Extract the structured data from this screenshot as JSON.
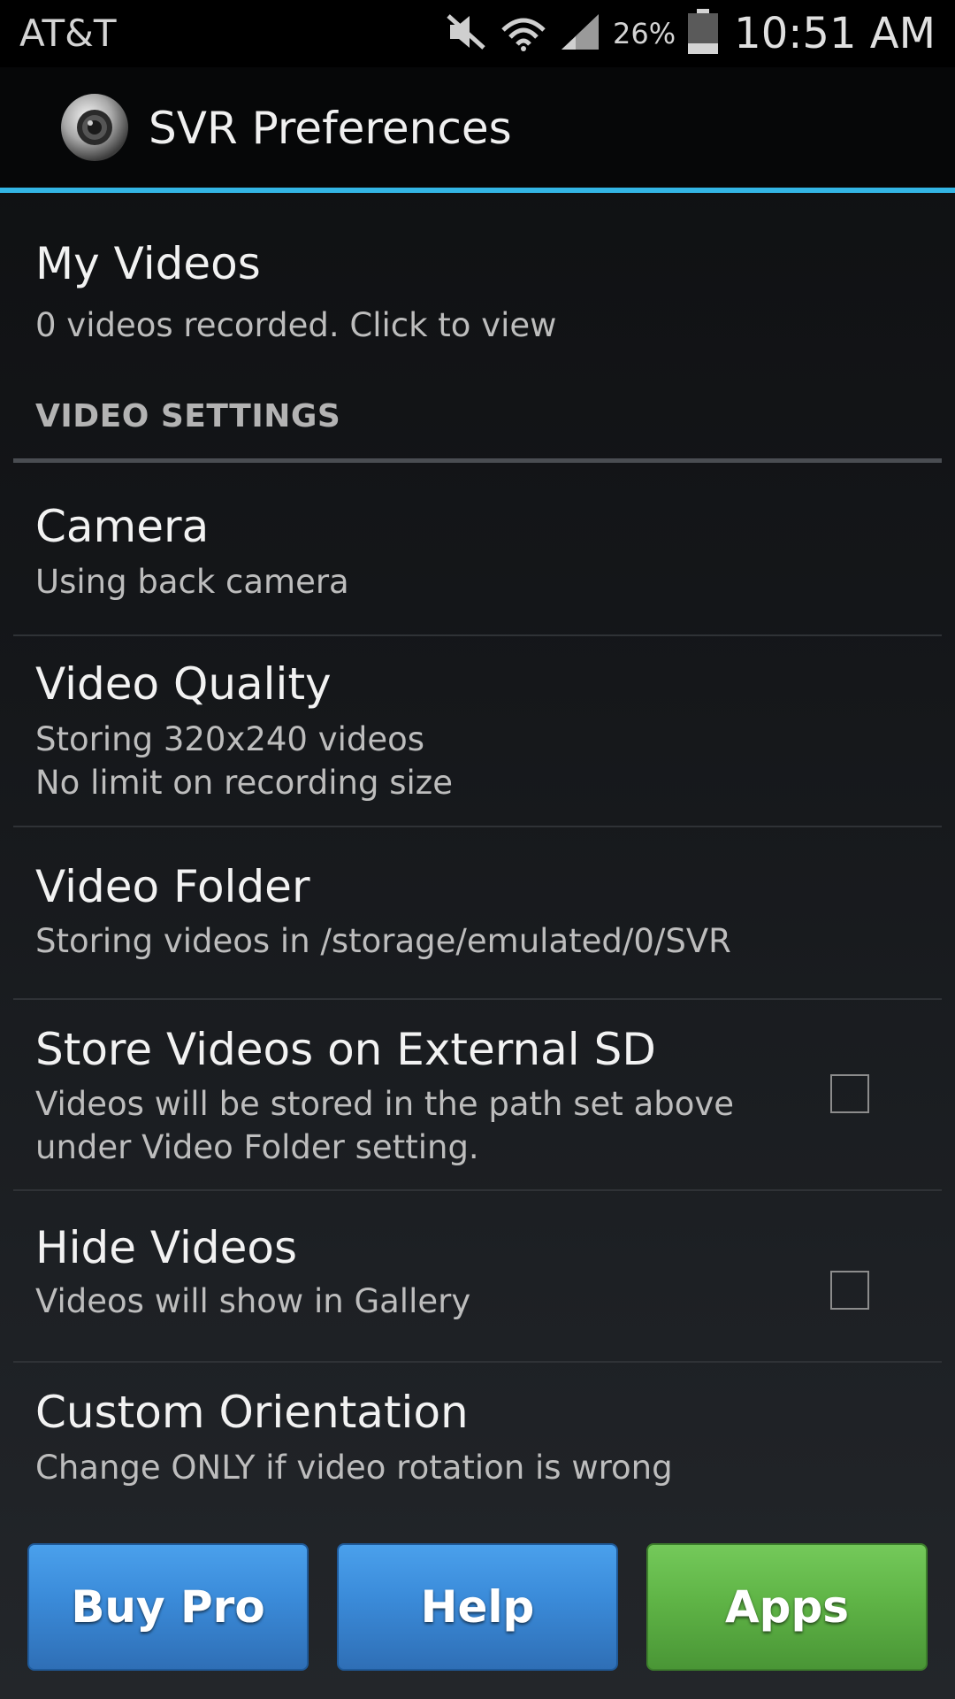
{
  "status_bar": {
    "carrier": "AT&T",
    "battery_percent": "26%",
    "time": "10:51 AM",
    "icons": [
      "mute-icon",
      "wifi-icon",
      "signal-icon",
      "battery-icon"
    ]
  },
  "action_bar": {
    "title": "SVR Preferences",
    "logo_icon": "camera-lens-icon",
    "accent_color": "#33b5e5"
  },
  "preferences": {
    "my_videos": {
      "title": "My Videos",
      "summary": "0 videos recorded. Click to view"
    },
    "section_video_settings": "VIDEO SETTINGS",
    "camera": {
      "title": "Camera",
      "summary": "Using back camera"
    },
    "video_quality": {
      "title": "Video Quality",
      "summary": "Storing 320x240 videos\nNo limit on recording size"
    },
    "video_folder": {
      "title": "Video Folder",
      "summary": "Storing videos in /storage/emulated/0/SVR"
    },
    "external_sd": {
      "title": "Store Videos on External SD",
      "summary": "Videos will be stored in the path set above\nunder Video Folder setting.",
      "checked": false
    },
    "hide_videos": {
      "title": "Hide Videos",
      "summary": "Videos will show in Gallery",
      "checked": false
    },
    "custom_orientation": {
      "title": "Custom Orientation",
      "summary": "Change ONLY if video rotation is wrong"
    }
  },
  "buttons": {
    "buy_pro": "Buy Pro",
    "help": "Help",
    "apps": "Apps",
    "blue_color": "#3a8ad8",
    "green_color": "#5fb446"
  }
}
